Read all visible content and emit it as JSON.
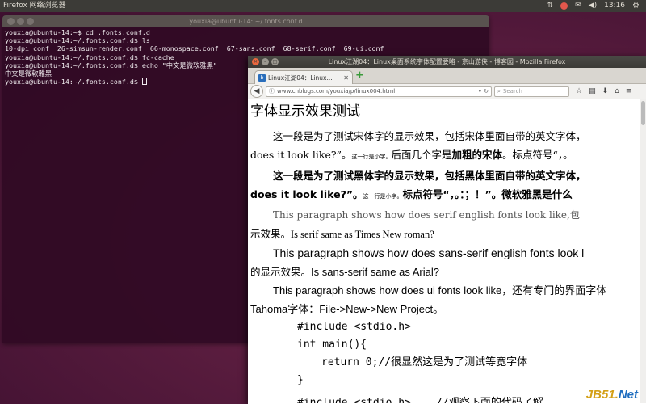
{
  "top_panel": {
    "app_title": "Firefox 网络浏览器",
    "clock": "13:16",
    "keyboard_indicator": "⇅",
    "volume_indicator": "◀)",
    "mail_indicator": "✉",
    "settings_indicator": "⚙"
  },
  "terminal": {
    "title": "youxia@ubuntu-14: ~/.fonts.conf.d",
    "lines": [
      "youxia@ubuntu-14:~$ cd .fonts.conf.d",
      "youxia@ubuntu-14:~/.fonts.conf.d$ ls",
      "10-dpi.conf  26-simsun-render.conf  66-monospace.conf  67-sans.conf  68-serif.conf  69-ui.conf",
      "youxia@ubuntu-14:~/.fonts.conf.d$ fc-cache",
      "youxia@ubuntu-14:~/.fonts.conf.d$ echo \"中文是微软雅黑\"",
      "中文是微软雅黑",
      "youxia@ubuntu-14:~/.fonts.conf.d$ "
    ]
  },
  "firefox": {
    "window_title": "Linux江湖04：Linux桌面系统字体配置要略 - 京山游侠 - 博客园 - Mozilla Firefox",
    "tab_label": "Linux江湖04：Linux...",
    "tab_favicon": "b",
    "url": "www.cnblogs.com/youxia/p/linux004.html",
    "search_placeholder": "Search",
    "page": {
      "title": "字体显示效果测试",
      "p1_a": "这一段是为了测试宋体字的显示效果，包括宋体里面自带的英文字体，",
      "p1_b1": "does it look like?”。",
      "p1_b_small": "这一行是小字。",
      "p1_b2": "后面几个字是",
      "p1_b_bold": "加粗的宋体",
      "p1_b3": "。标点符号“，。",
      "p2_a": "这一段是为了测试黑体字的显示效果，包括黑体里面自带的英文字体，",
      "p2_b1": "does it look like?”。",
      "p2_b_small": "这一行是小字。",
      "p2_b2": "标点符号“，。：；！”。微软雅黑是什么",
      "p3_a": "This paragraph shows how does serif english fonts look like,包",
      "p3_b1": "示效果。",
      "p3_b2": "Is serif same as Times New roman?",
      "p4_a": "This paragraph shows how does sans-serif english fonts look l",
      "p4_b1": "的显示效果。",
      "p4_b2": "Is sans-serif same as Arial?",
      "p5_a": "This paragraph shows how does ui fonts look like，还有专门的界面字体",
      "p5_b": "Tahoma字体：File->New->New Project。",
      "code": [
        "#include <stdio.h>",
        "int main(){",
        "return 0;//很显然这是为了测试等宽字体",
        "}",
        "#include <stdio.h>    //观察下面的代码了解"
      ]
    },
    "watermark_a": "JB51.",
    "watermark_b": "Net"
  },
  "colors": {
    "desktop_bg": "#5b1d3f",
    "terminal_bg": "#300a24",
    "panel_bg": "#3c3b37",
    "close_button": "#e9673f"
  }
}
